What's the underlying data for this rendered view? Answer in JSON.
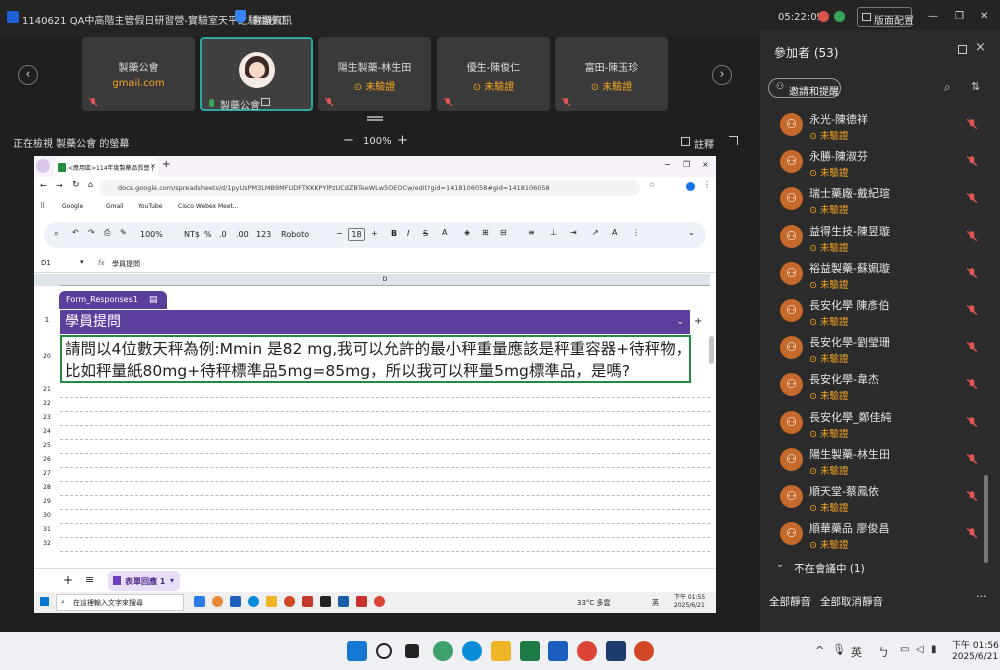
{
  "titlebar": {
    "title": "1140621 QA中高階主管假日研習營-實驗室天平之驗證校正",
    "meeting_info": "會議資訊",
    "time": "05:22:09",
    "layout": "版面配置",
    "minimize": "—",
    "restore": "❐",
    "close": "✕"
  },
  "thumbnails": [
    {
      "name": "製藥公會",
      "sub": "gmail.com",
      "sub_color": "#f5a623"
    },
    {
      "name": "製藥公會",
      "sub": "",
      "active": true
    },
    {
      "name": "陽生製藥-林生田",
      "sub": "⊙ 未驗證"
    },
    {
      "name": "優生-陳俊仁",
      "sub": "⊙ 未驗證"
    },
    {
      "name": "富田-陳玉珍",
      "sub": "⊙ 未驗證"
    }
  ],
  "viewbar": {
    "viewing": "正在檢視 製藥公會 的螢幕",
    "zoom_minus": "−",
    "zoom": "100%",
    "zoom_plus": "+",
    "annotate": "註釋"
  },
  "browser": {
    "tab_title": "<應用區>114年度製藥品質營 |",
    "url": "docs.google.com/spreadsheets/d/1pyUsPM3LMB9MFUDFTKKKPYlPzUCdZBTeeWLw5OEOCw/edit?gid=1418106058#gid=1418106058",
    "bookmarks": [
      "Google",
      "Gmail",
      "YouTube",
      "Cisco Webex Meet..."
    ]
  },
  "sheet": {
    "toolbar": {
      "zoom": "100%",
      "currency": "NT$",
      "percent": "%",
      "dec_minus": ".0",
      "dec_plus": ".00",
      "format": "123",
      "font": "Roboto",
      "font_size": "18",
      "minus": "−",
      "plus": "+"
    },
    "cell_ref": "D1",
    "fx": "fx",
    "formula_value": "學員提問",
    "column": "D",
    "table_name": "Form_Responses1",
    "header": "學員提問",
    "row_header_num": "1",
    "row_main_num": "20",
    "question_line1": "請問以4位數天秤為例:Mmin 是82 mg,我可以允許的最小秤重量應該是秤重容器+待秤物，",
    "question_line2": "比如秤量紙80mg+待秤標準品5mg=85mg，所以我可以秤量5mg標準品，是嗎?",
    "rows": [
      "21",
      "22",
      "23",
      "24",
      "25",
      "26",
      "27",
      "28",
      "29",
      "30",
      "31",
      "32"
    ],
    "sheet_tab": "表單回應 1",
    "add_sheet": "+",
    "all_sheets": "≡"
  },
  "inner_taskbar": {
    "search": "在這裡輸入文字來搜尋",
    "weather": "33°C 多雲",
    "lang": "英",
    "time": "下午 01:55",
    "date": "2025/6/21"
  },
  "participants": {
    "title": "參加者 (53)",
    "invite": "邀請和提醒",
    "list": [
      {
        "name": "永光-陳德祥",
        "status": "⊙ 未驗證"
      },
      {
        "name": "永勝-陳淑芬",
        "status": "⊙ 未驗證"
      },
      {
        "name": "瑞士藥廠-戴紀瑄",
        "status": "⊙ 未驗證"
      },
      {
        "name": "益得生技-陳昱璇",
        "status": "⊙ 未驗證"
      },
      {
        "name": "裕益製藥-蘇姵璇",
        "status": "⊙ 未驗證"
      },
      {
        "name": "長安化學 陳彥伯",
        "status": "⊙ 未驗證"
      },
      {
        "name": "長安化學-劉瑩珊",
        "status": "⊙ 未驗證"
      },
      {
        "name": "長安化學-韋杰",
        "status": "⊙ 未驗證"
      },
      {
        "name": "長安化學_鄭佳純",
        "status": "⊙ 未驗證"
      },
      {
        "name": "陽生製藥-林生田",
        "status": "⊙ 未驗證"
      },
      {
        "name": "順天堂-蔡鳳依",
        "status": "⊙ 未驗證"
      },
      {
        "name": "順華藥品 廖俊昌",
        "status": "⊙ 未驗證"
      }
    ],
    "not_in_meeting": "不在會議中 (1)",
    "mute_all": "全部靜音",
    "unmute_all": "全部取消靜音",
    "more": "···"
  },
  "taskbar": {
    "lang": "英",
    "time": "下午 01:56",
    "date": "2025/6/21"
  },
  "colors": {
    "accent": "#2ea6a3",
    "unverified": "#f5a623",
    "table_purple": "#5b3f9d",
    "cell_border": "#1e8e3e"
  }
}
